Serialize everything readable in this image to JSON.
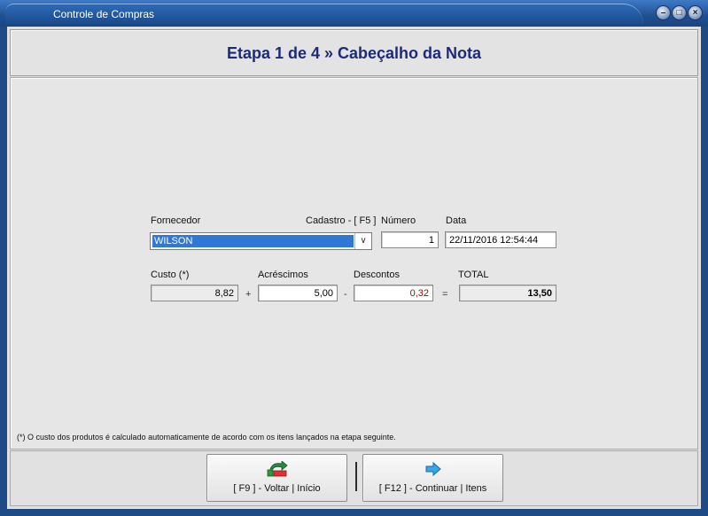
{
  "window": {
    "title": "Controle de Compras"
  },
  "header": {
    "title": "Etapa 1 de 4 » Cabeçalho da Nota"
  },
  "form": {
    "fornecedor_label": "Fornecedor",
    "cadastro_label": "Cadastro - [ F5 ]",
    "fornecedor_value": "WILSON",
    "numero_label": "Número",
    "numero_value": "1",
    "data_label": "Data",
    "data_value": "22/11/2016 12:54:44",
    "custo_label": "Custo (*)",
    "custo_value": "8,82",
    "acrescimos_label": "Acréscimos",
    "acrescimos_value": "5,00",
    "descontos_label": "Descontos",
    "descontos_value": "0,32",
    "total_label": "TOTAL",
    "total_value": "13,50",
    "op_plus": "+",
    "op_minus": "-",
    "op_equals": "="
  },
  "footnote": "(*) O custo dos produtos é calculado automaticamente de acordo com os itens lançados na etapa seguinte.",
  "buttons": {
    "back_label": "[ F9 ] - Voltar | Início",
    "next_label": "[ F12 ] - Continuar | Itens"
  },
  "icons": {
    "back": "return-arrow-icon",
    "next": "right-arrow-icon",
    "minimize": "minimize-icon",
    "maximize": "maximize-icon",
    "close": "close-icon"
  }
}
